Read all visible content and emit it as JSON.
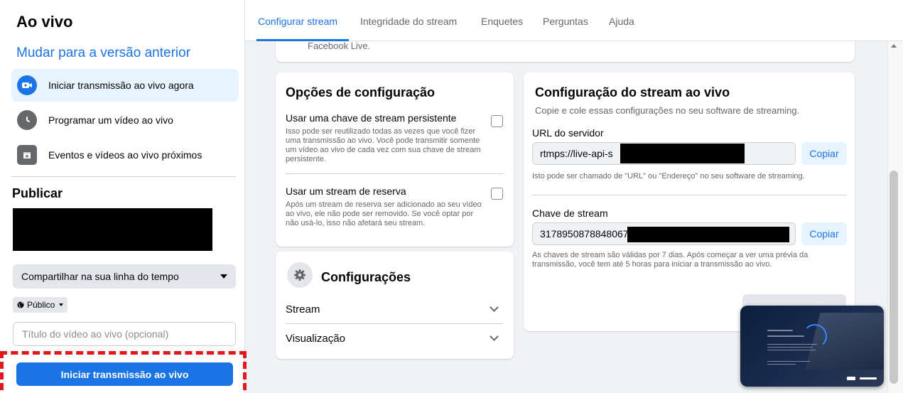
{
  "sidebar": {
    "title": "Ao vivo",
    "switch_link": "Mudar para a versão anterior",
    "items": [
      {
        "label": "Iniciar transmissão ao vivo agora",
        "icon": "live-camera-icon"
      },
      {
        "label": "Programar um vídeo ao vivo",
        "icon": "clock-icon"
      },
      {
        "label": "Eventos e vídeos ao vivo próximos",
        "icon": "calendar-icon"
      }
    ],
    "publish_heading": "Publicar",
    "share_select": "Compartilhar na sua linha do tempo",
    "privacy": "Público",
    "title_placeholder": "Título do vídeo ao vivo (opcional)",
    "start_button": "Iniciar transmissão ao vivo"
  },
  "tabs": [
    "Configurar stream",
    "Integridade do stream",
    "Enquetes",
    "Perguntas",
    "Ajuda"
  ],
  "top_card_text": "Facebook Live.",
  "options": {
    "title": "Opções de configuração",
    "persistent_key_label": "Usar uma chave de stream persistente",
    "persistent_key_desc": "Isso pode ser reutilizado todas as vezes que você fizer uma transmissão ao vivo. Você pode transmitir somente um vídeo ao vivo de cada vez com sua chave de stream persistente.",
    "backup_label": "Usar um stream de reserva",
    "backup_desc": "Após um stream de reserva ser adicionado ao seu vídeo ao vivo, ele não pode ser removido. Se você optar por não usá-lo, isso não afetará seu stream."
  },
  "settings": {
    "title": "Configurações",
    "stream_label": "Stream",
    "preview_label": "Visualização"
  },
  "stream_config": {
    "title": "Configuração do stream ao vivo",
    "subtitle": "Copie e cole essas configurações no seu software de streaming.",
    "server_url_label": "URL do servidor",
    "server_url_value": "rtmps://live-api-s",
    "copy_label": "Copiar",
    "server_help": "Isto pode ser chamado de \"URL\" ou \"Endereço\" no seu software de streaming.",
    "stream_key_label": "Chave de stream",
    "stream_key_value": "3178950878848067",
    "key_help": "As chaves de stream são válidas por 7 dias. Após começar a ver uma prévia da transmissão, você tem até 5 horas para iniciar a transmissão ao vivo."
  },
  "colors": {
    "accent": "#1b74e4",
    "highlight_border": "#e0191e"
  }
}
